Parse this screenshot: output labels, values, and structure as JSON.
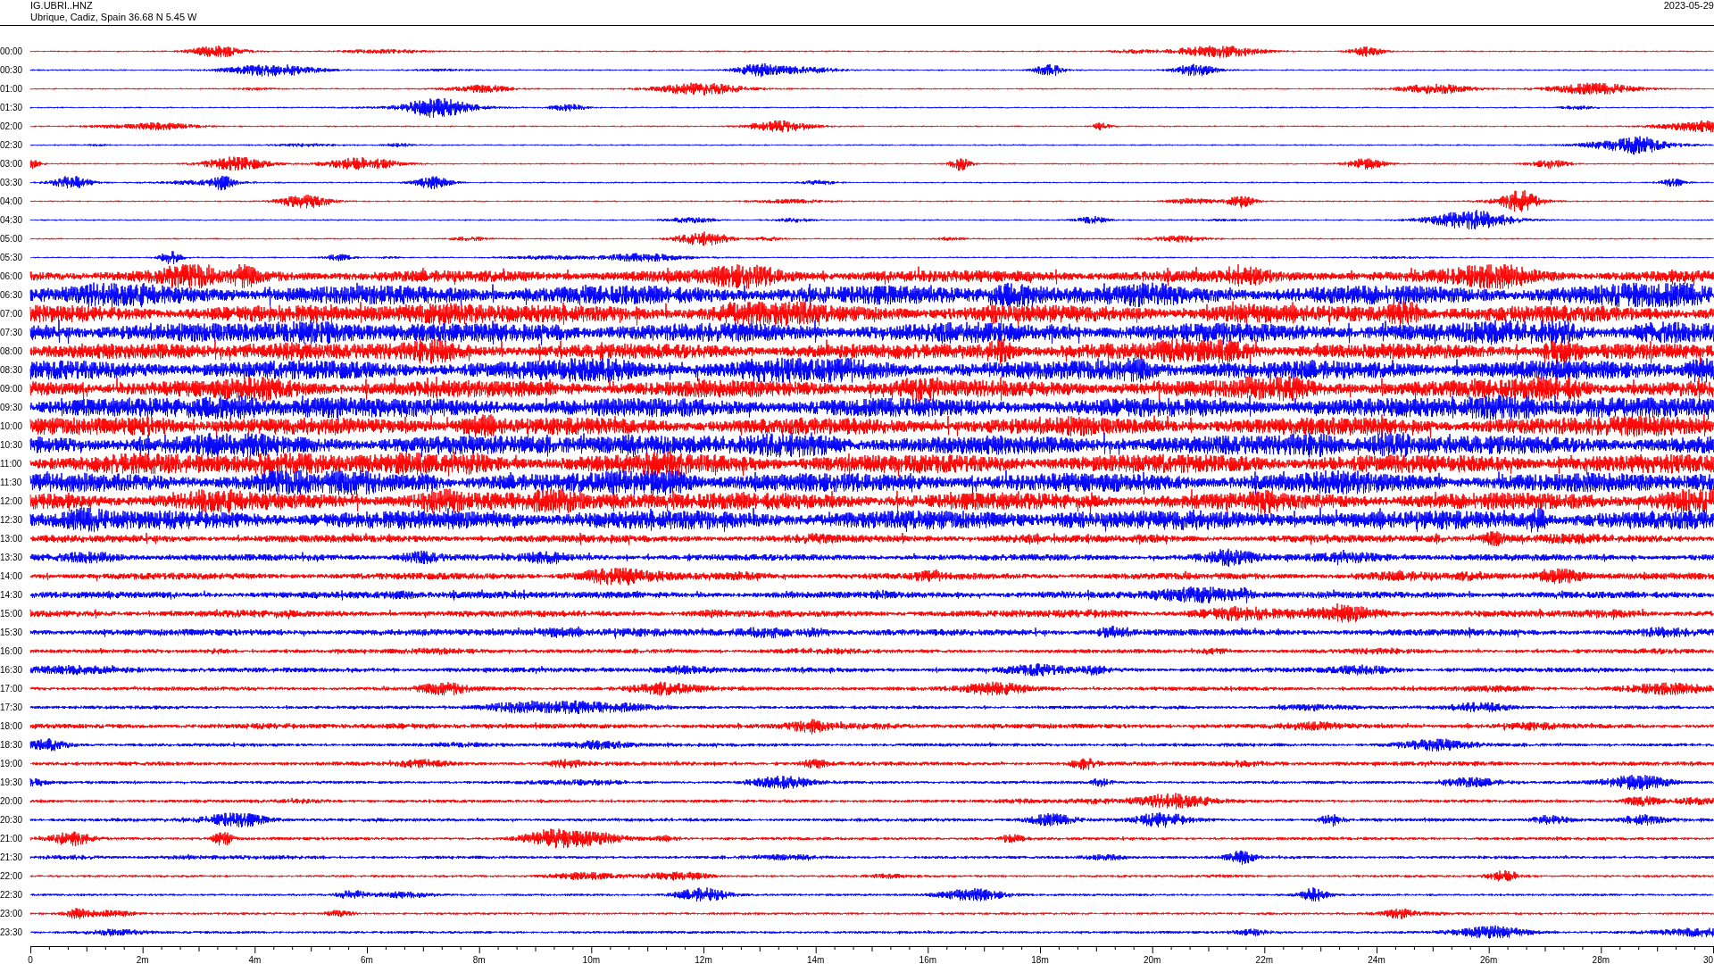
{
  "header": {
    "station": "IG.UBRI..HNZ",
    "location": "Ubrique, Cadiz, Spain  36.68 N 5.45 W",
    "date": "2023-05-29"
  },
  "rows": [
    {
      "label": "00:00",
      "color": "#ff0000"
    },
    {
      "label": "00:30",
      "color": "#0000ff"
    },
    {
      "label": "01:00",
      "color": "#ff0000"
    },
    {
      "label": "01:30",
      "color": "#0000ff"
    },
    {
      "label": "02:00",
      "color": "#ff0000"
    },
    {
      "label": "02:30",
      "color": "#0000ff"
    },
    {
      "label": "03:00",
      "color": "#ff0000"
    },
    {
      "label": "03:30",
      "color": "#0000ff"
    },
    {
      "label": "04:00",
      "color": "#ff0000"
    },
    {
      "label": "04:30",
      "color": "#0000ff"
    },
    {
      "label": "05:00",
      "color": "#ff0000"
    },
    {
      "label": "05:30",
      "color": "#0000ff"
    },
    {
      "label": "06:00",
      "color": "#ff0000"
    },
    {
      "label": "06:30",
      "color": "#0000ff"
    },
    {
      "label": "07:00",
      "color": "#ff0000"
    },
    {
      "label": "07:30",
      "color": "#0000ff"
    },
    {
      "label": "08:00",
      "color": "#ff0000"
    },
    {
      "label": "08:30",
      "color": "#0000ff"
    },
    {
      "label": "09:00",
      "color": "#ff0000"
    },
    {
      "label": "09:30",
      "color": "#0000ff"
    },
    {
      "label": "10:00",
      "color": "#ff0000"
    },
    {
      "label": "10:30",
      "color": "#0000ff"
    },
    {
      "label": "11:00",
      "color": "#ff0000"
    },
    {
      "label": "11:30",
      "color": "#0000ff"
    },
    {
      "label": "12:00",
      "color": "#ff0000"
    },
    {
      "label": "12:30",
      "color": "#0000ff"
    },
    {
      "label": "13:00",
      "color": "#ff0000"
    },
    {
      "label": "13:30",
      "color": "#0000ff"
    },
    {
      "label": "14:00",
      "color": "#ff0000"
    },
    {
      "label": "14:30",
      "color": "#0000ff"
    },
    {
      "label": "15:00",
      "color": "#ff0000"
    },
    {
      "label": "15:30",
      "color": "#0000ff"
    },
    {
      "label": "16:00",
      "color": "#ff0000"
    },
    {
      "label": "16:30",
      "color": "#0000ff"
    },
    {
      "label": "17:00",
      "color": "#ff0000"
    },
    {
      "label": "17:30",
      "color": "#0000ff"
    },
    {
      "label": "18:00",
      "color": "#ff0000"
    },
    {
      "label": "18:30",
      "color": "#0000ff"
    },
    {
      "label": "19:00",
      "color": "#ff0000"
    },
    {
      "label": "19:30",
      "color": "#0000ff"
    },
    {
      "label": "20:00",
      "color": "#ff0000"
    },
    {
      "label": "20:30",
      "color": "#0000ff"
    },
    {
      "label": "21:00",
      "color": "#ff0000"
    },
    {
      "label": "21:30",
      "color": "#0000ff"
    },
    {
      "label": "22:00",
      "color": "#ff0000"
    },
    {
      "label": "22:30",
      "color": "#0000ff"
    },
    {
      "label": "23:00",
      "color": "#ff0000"
    },
    {
      "label": "23:30",
      "color": "#0000ff"
    }
  ],
  "x_axis": {
    "labels": [
      "0",
      "2m",
      "4m",
      "6m",
      "8m",
      "10m",
      "12m",
      "14m",
      "16m",
      "18m",
      "20m",
      "22m",
      "24m",
      "26m",
      "28m",
      "30"
    ]
  }
}
